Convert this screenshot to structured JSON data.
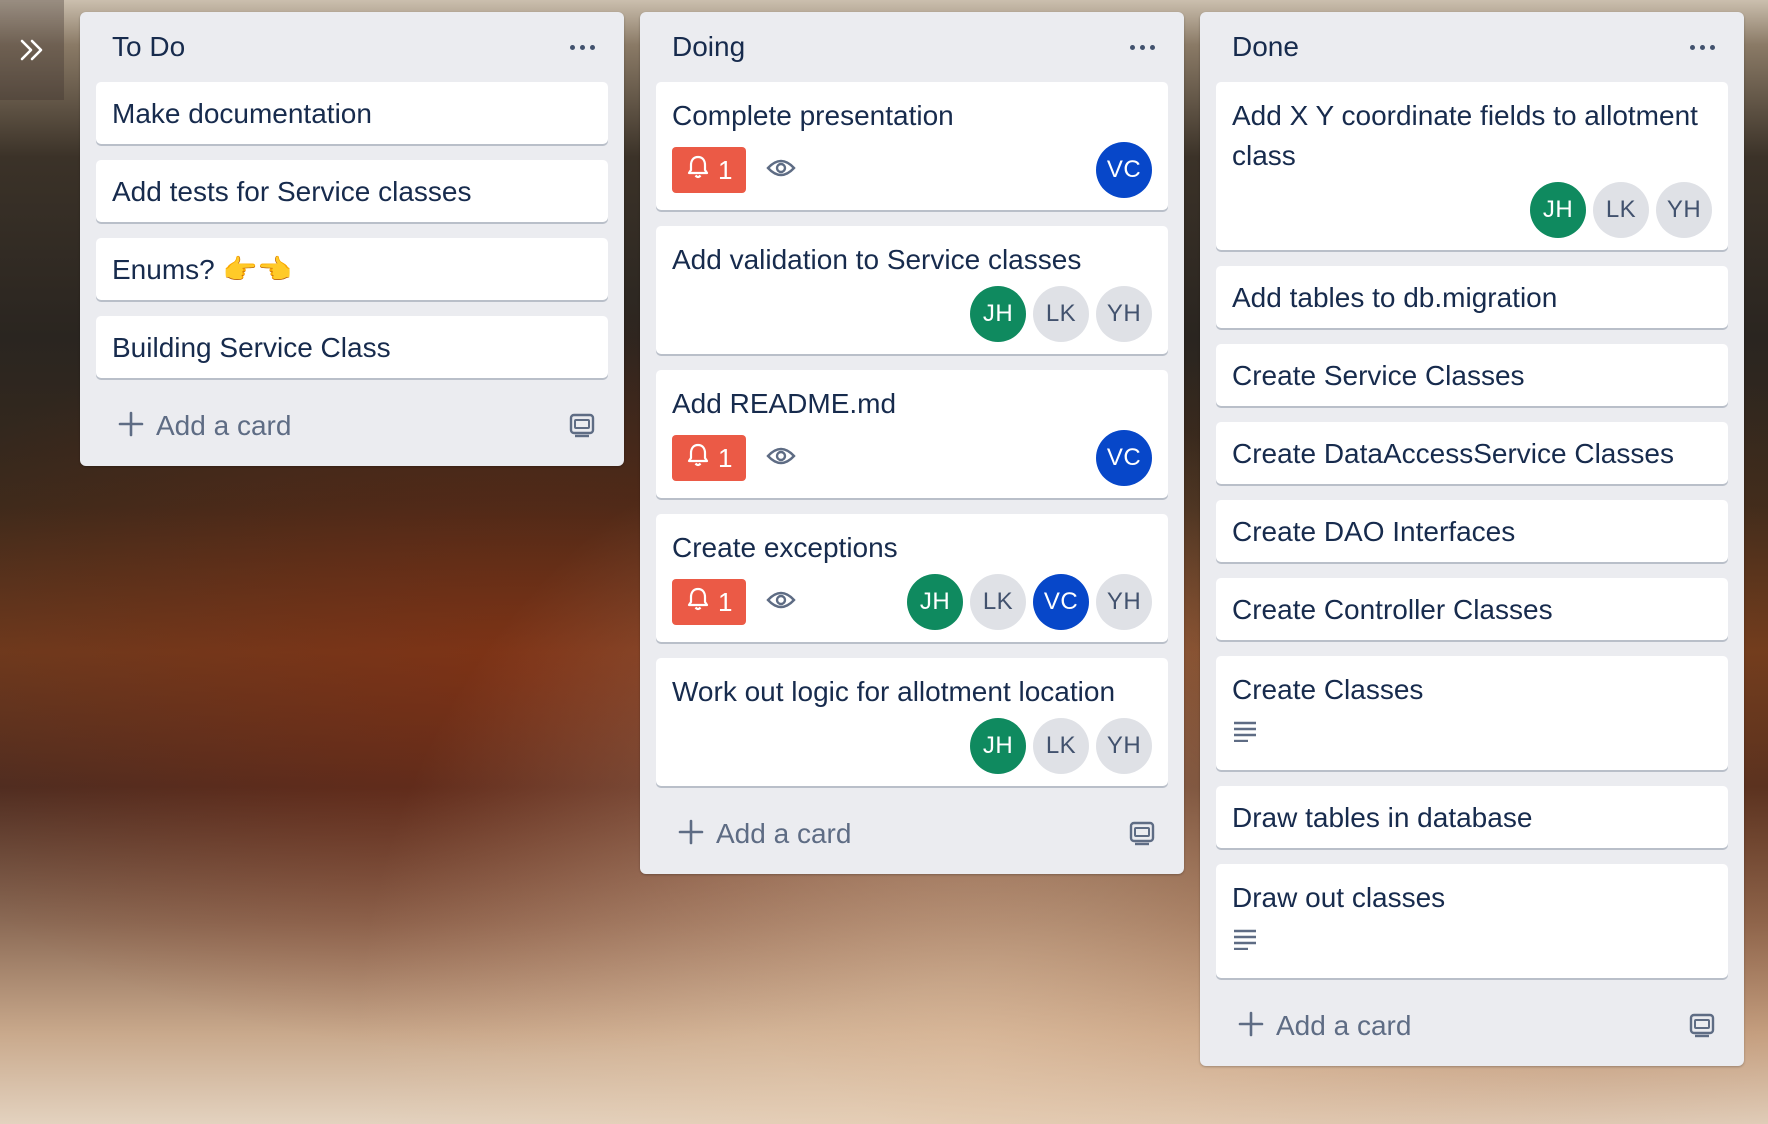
{
  "board": {
    "expand_icon": "double-chevron-right-icon",
    "lists": [
      {
        "title": "To Do",
        "cards": [
          {
            "title": "Make documentation"
          },
          {
            "title": "Add tests for Service classes"
          },
          {
            "title": "Enums? 👉👈"
          },
          {
            "title": "Building Service Class"
          }
        ],
        "add_label": "Add a card"
      },
      {
        "title": "Doing",
        "cards": [
          {
            "title": "Complete presentation",
            "due_count": "1",
            "watching": true,
            "members": [
              "VC"
            ]
          },
          {
            "title": "Add validation to Service classes",
            "members": [
              "JH",
              "LK",
              "YH"
            ]
          },
          {
            "title": "Add README.md",
            "due_count": "1",
            "watching": true,
            "members": [
              "VC"
            ]
          },
          {
            "title": "Create exceptions",
            "due_count": "1",
            "watching": true,
            "members": [
              "JH",
              "LK",
              "VC",
              "YH"
            ]
          },
          {
            "title": "Work out logic for allotment location",
            "members": [
              "JH",
              "LK",
              "YH"
            ]
          }
        ],
        "add_label": "Add a card"
      },
      {
        "title": "Done",
        "cards": [
          {
            "title": "Add X Y coordinate fields to allotment class",
            "members": [
              "JH",
              "LK",
              "YH"
            ]
          },
          {
            "title": "Add tables to db.migration"
          },
          {
            "title": "Create Service Classes"
          },
          {
            "title": "Create DataAccessService Classes"
          },
          {
            "title": "Create DAO Interfaces"
          },
          {
            "title": "Create Controller Classes"
          },
          {
            "title": "Create Classes",
            "has_description": true
          },
          {
            "title": "Draw tables in database"
          },
          {
            "title": "Draw out classes",
            "has_description": true
          }
        ],
        "add_label": "Add a card"
      }
    ]
  },
  "colors": {
    "due_badge": "#eb5a46",
    "avatar_JH": "#0f8a5f",
    "avatar_VC": "#0747c9",
    "avatar_other": "#dfe1e6",
    "list_bg": "#ebecf0"
  }
}
